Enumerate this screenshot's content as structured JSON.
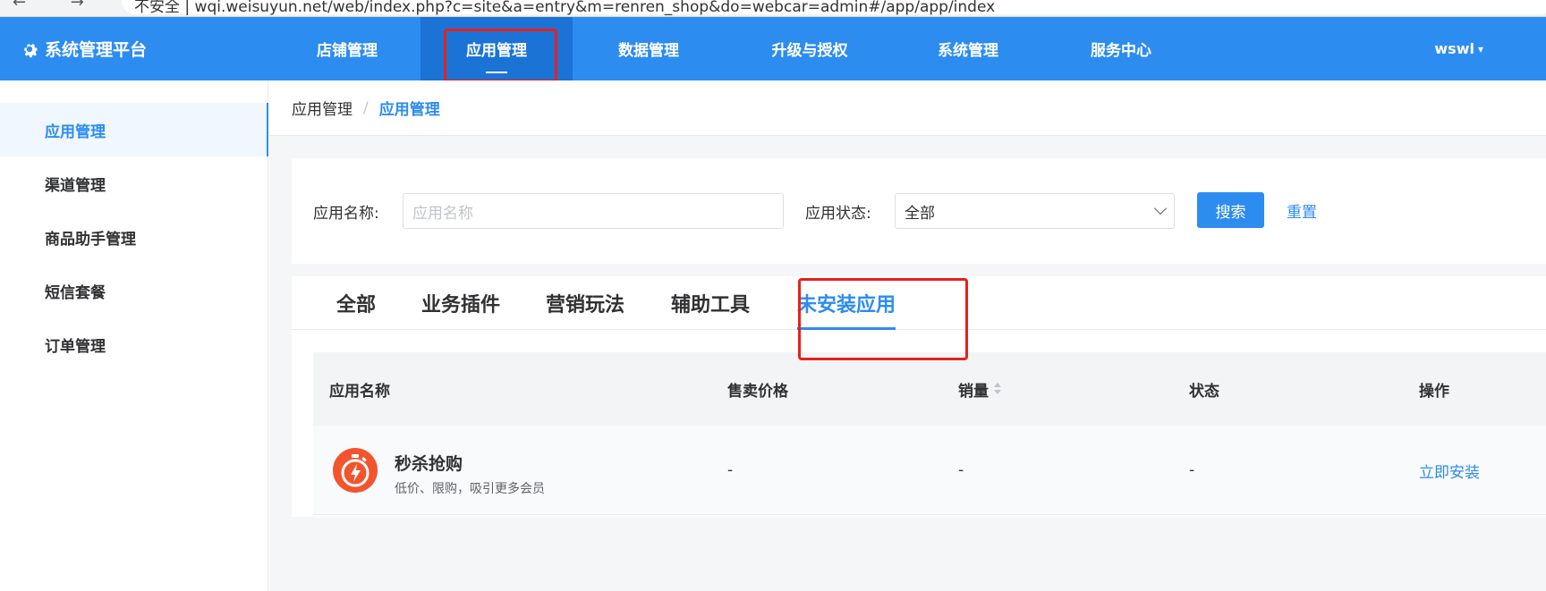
{
  "browser": {
    "nav_glyphs": "← → ↻",
    "url": "不安全 | wqi.weisuyun.net/web/index.php?c=site&a=entry&m=renren_shop&do=webcar=admin#/app/app/index"
  },
  "header": {
    "brand": "系统管理平台",
    "nav": [
      "店铺管理",
      "应用管理",
      "数据管理",
      "升级与授权",
      "系统管理",
      "服务中心"
    ],
    "active_nav": "应用管理",
    "user": "wswl"
  },
  "sidebar": {
    "items": [
      "应用管理",
      "渠道管理",
      "商品助手管理",
      "短信套餐",
      "订单管理"
    ],
    "active": "应用管理"
  },
  "breadcrumb": {
    "parent": "应用管理",
    "separator": "/",
    "current": "应用管理"
  },
  "filter": {
    "name_label": "应用名称:",
    "name_placeholder": "应用名称",
    "status_label": "应用状态:",
    "status_value": "全部",
    "search_button": "搜索",
    "reset_link": "重置"
  },
  "tabs": [
    "全部",
    "业务插件",
    "营销玩法",
    "辅助工具",
    "未安装应用"
  ],
  "active_tab": "未安装应用",
  "table": {
    "columns": [
      "应用名称",
      "售卖价格",
      "销量",
      "状态",
      "操作"
    ],
    "rows": [
      {
        "name": "秒杀抢购",
        "desc": "低价、限购，吸引更多会员",
        "price": "-",
        "sales": "-",
        "status": "-",
        "action": "立即安装",
        "icon": "stopwatch-lightning-icon"
      }
    ]
  },
  "colors": {
    "primary": "#2d8cf0",
    "header_active": "#1b73d6",
    "highlight_box": "#e8201a",
    "app_icon": "#f2542d"
  }
}
